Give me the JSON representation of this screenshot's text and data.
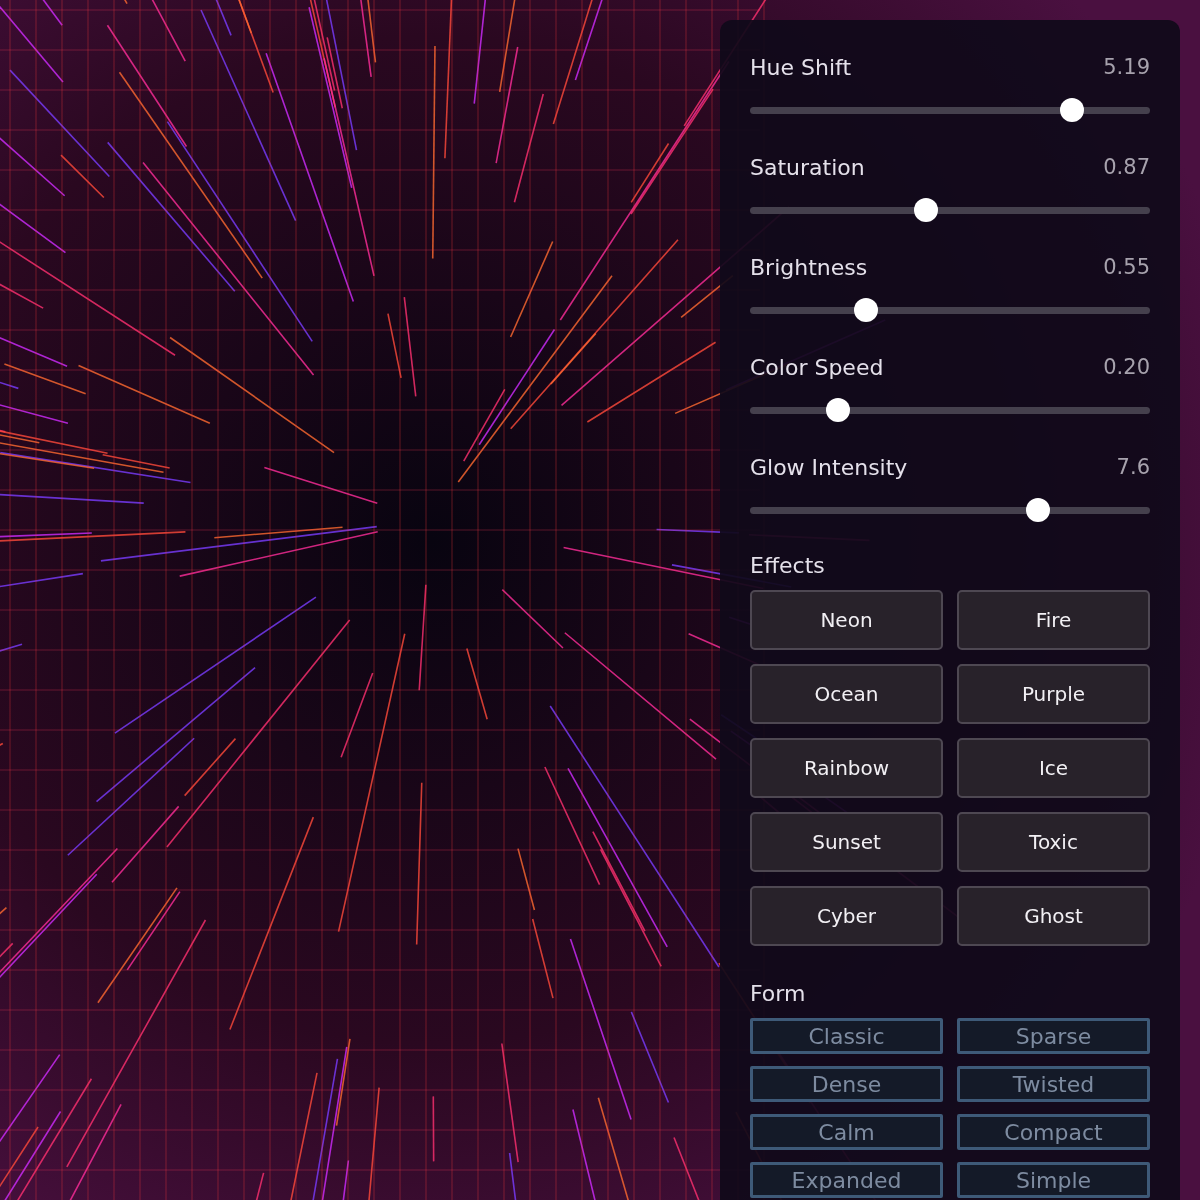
{
  "sliders": [
    {
      "label": "Hue Shift",
      "reading": "5.19",
      "level": 0.805
    },
    {
      "label": "Saturation",
      "reading": "0.87",
      "level": 0.44
    },
    {
      "label": "Brightness",
      "reading": "0.55",
      "level": 0.29
    },
    {
      "label": "Color Speed",
      "reading": "0.20",
      "level": 0.22
    },
    {
      "label": "Glow Intensity",
      "reading": "7.6",
      "level": 0.72
    }
  ],
  "effects": {
    "title": "Effects",
    "buttons": [
      {
        "label": "Neon",
        "disabled": false
      },
      {
        "label": "Fire",
        "disabled": false
      },
      {
        "label": "Ocean",
        "disabled": false
      },
      {
        "label": "Purple",
        "disabled": false
      },
      {
        "label": "Rainbow",
        "disabled": false
      },
      {
        "label": "Ice",
        "disabled": false
      },
      {
        "label": "Sunset",
        "disabled": false
      },
      {
        "label": "Toxic",
        "disabled": false
      },
      {
        "label": "Cyber",
        "disabled": false
      },
      {
        "label": "Ghost",
        "disabled": false
      }
    ]
  },
  "form": {
    "title": "Form",
    "buttons": [
      {
        "label": "Classic",
        "disabled": true
      },
      {
        "label": "Sparse",
        "disabled": true
      },
      {
        "label": "Dense",
        "disabled": true
      },
      {
        "label": "Twisted",
        "disabled": true
      },
      {
        "label": "Calm",
        "disabled": true
      },
      {
        "label": "Compact",
        "disabled": true
      },
      {
        "label": "Expanded",
        "disabled": true
      },
      {
        "label": "Simple",
        "disabled": true
      }
    ]
  }
}
